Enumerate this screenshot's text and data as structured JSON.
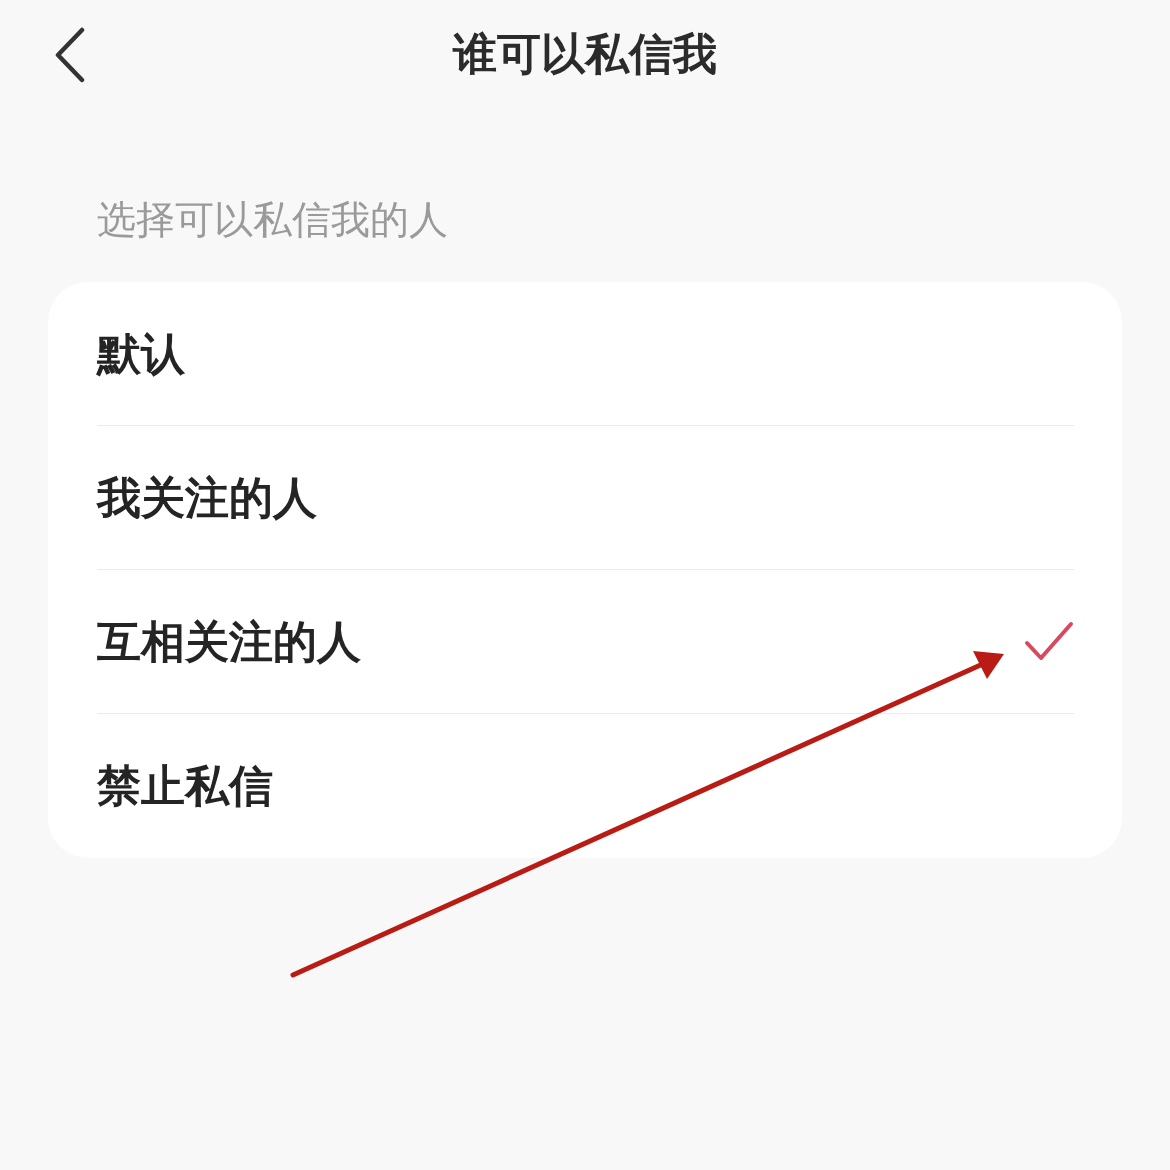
{
  "header": {
    "title": "谁可以私信我"
  },
  "section": {
    "label": "选择可以私信我的人"
  },
  "options": [
    {
      "label": "默认",
      "selected": false
    },
    {
      "label": "我关注的人",
      "selected": false
    },
    {
      "label": "互相关注的人",
      "selected": true
    },
    {
      "label": "禁止私信",
      "selected": false
    }
  ]
}
